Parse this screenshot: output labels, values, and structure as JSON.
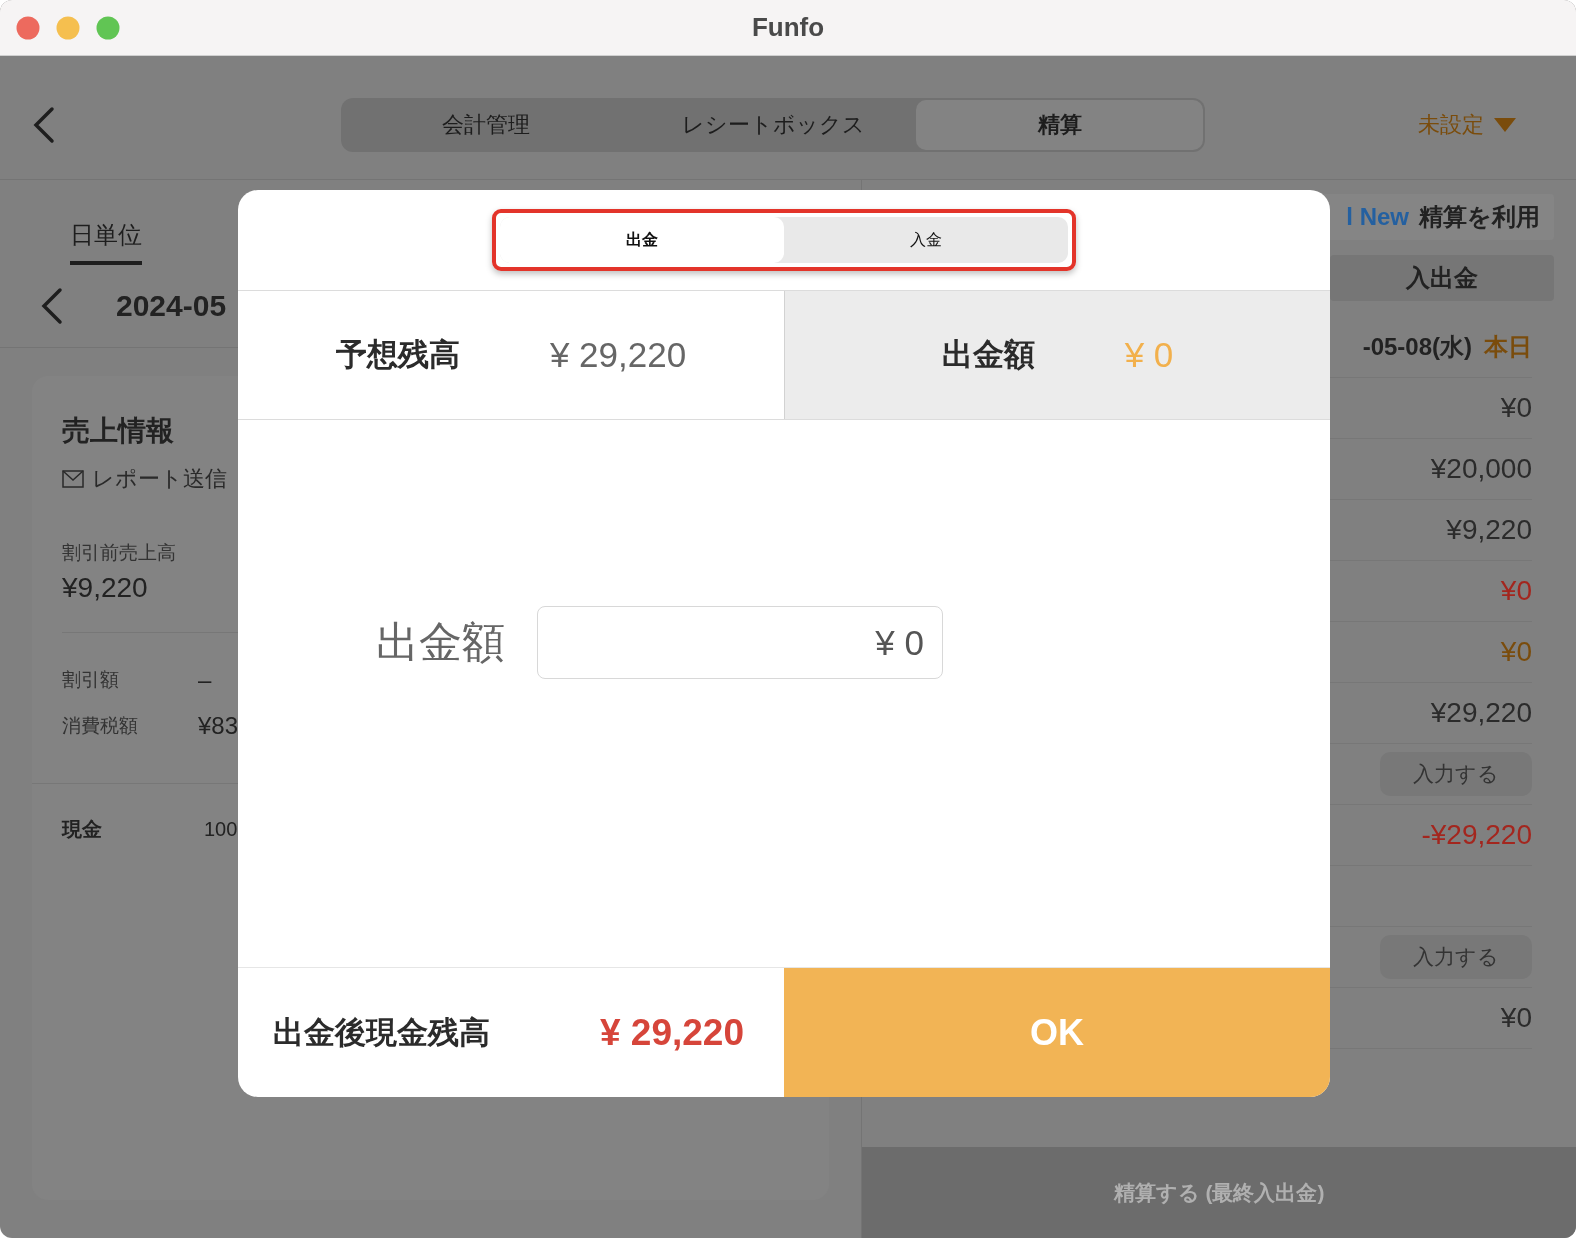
{
  "window": {
    "title": "Funfo"
  },
  "top_bar": {
    "tabs": [
      {
        "label": "会計管理",
        "selected": false
      },
      {
        "label": "レシートボックス",
        "selected": false
      },
      {
        "label": "精算",
        "selected": true
      }
    ],
    "register_selector": "未設定"
  },
  "left_panel": {
    "period_tabs": [
      {
        "label": "日単位",
        "selected": true
      }
    ],
    "date": "2024-05",
    "sales_card": {
      "title": "売上情報",
      "report_link": "レポート送信",
      "gross_label": "割引前売上高",
      "gross_value": "¥9,220",
      "rows": [
        {
          "label": "割引額",
          "value": "–"
        },
        {
          "label": "消費税額",
          "value": "¥83"
        }
      ],
      "payment": {
        "label": "現金",
        "value": "100"
      }
    }
  },
  "right_panel": {
    "promo": {
      "highlight": "l New",
      "text": "精算を利用"
    },
    "cash_button": "入出金",
    "date": "-05-08(水)",
    "today_badge": "本日",
    "rows": [
      {
        "kind": "amount",
        "value": "¥0",
        "color": "#2b2b2b"
      },
      {
        "kind": "amount",
        "value": "¥20,000",
        "color": "#2b2b2b"
      },
      {
        "kind": "amount",
        "value": "¥9,220",
        "color": "#2b2b2b"
      },
      {
        "kind": "amount",
        "value": "¥0",
        "color": "#a3261e"
      },
      {
        "kind": "amount",
        "value": "¥0",
        "color": "#7a4c0c"
      },
      {
        "kind": "amount",
        "value": "¥29,220",
        "color": "#2b2b2b"
      },
      {
        "kind": "button",
        "label": "入力する"
      },
      {
        "kind": "amount",
        "value": "-¥29,220",
        "color": "#a3261e"
      },
      {
        "kind": "empty"
      },
      {
        "kind": "button",
        "label": "入力する"
      },
      {
        "kind": "amount",
        "value": "¥0",
        "color": "#2b2b2b"
      }
    ],
    "settle_button": "精算する (最終入出金)"
  },
  "dialog": {
    "highlighted": true,
    "tabs": [
      {
        "label": "出金",
        "selected": true
      },
      {
        "label": "入金",
        "selected": false
      }
    ],
    "expected_balance": {
      "label": "予想残高",
      "value": "¥ 29,220"
    },
    "amount_summary": {
      "label": "出金額",
      "value": "¥ 0"
    },
    "input": {
      "label": "出金額",
      "value": "¥ 0"
    },
    "result": {
      "label": "出金後現金残高",
      "value": "¥ 29,220"
    },
    "ok_button": "OK"
  }
}
